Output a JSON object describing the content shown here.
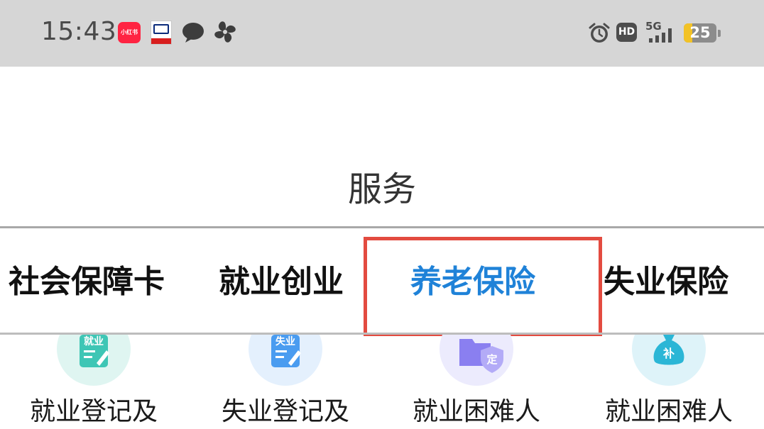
{
  "status_bar": {
    "time": "15:43",
    "notification_icons": [
      "xiaohongshu-app-icon",
      "news-app-icon",
      "message-bubble-icon",
      "pinwheel-icon"
    ],
    "xiaohongshu_label": "小红书",
    "system_icons": [
      "alarm-icon",
      "hd-icon",
      "5g-signal-icon",
      "battery-icon"
    ],
    "hd_label": "HD",
    "network": "5G",
    "battery_level": "25",
    "battery_fraction": 0.25,
    "battery_color": "#f2c226"
  },
  "header": {
    "title": "服务"
  },
  "tabs": {
    "active_index": 2,
    "active_color": "#1f82d8",
    "highlight_color": "#e34b40",
    "items": [
      {
        "label": "社会保障卡"
      },
      {
        "label": "就业创业"
      },
      {
        "label": "养老保险"
      },
      {
        "label": "失业保险"
      }
    ]
  },
  "services": [
    {
      "label": "就业登记及",
      "icon": "employment-registration-icon",
      "icon_text": "就业",
      "icon_color": "#3ec6b5"
    },
    {
      "label": "失业登记及",
      "icon": "unemployment-registration-icon",
      "icon_text": "失业",
      "icon_color": "#4a9cf0"
    },
    {
      "label": "就业困难人",
      "icon": "employment-difficulty-certification-icon",
      "icon_text": "定",
      "icon_color": "#8a7ff0"
    },
    {
      "label": "就业困难人",
      "icon": "employment-difficulty-subsidy-icon",
      "icon_text": "补",
      "icon_color": "#2bb6d6"
    }
  ]
}
